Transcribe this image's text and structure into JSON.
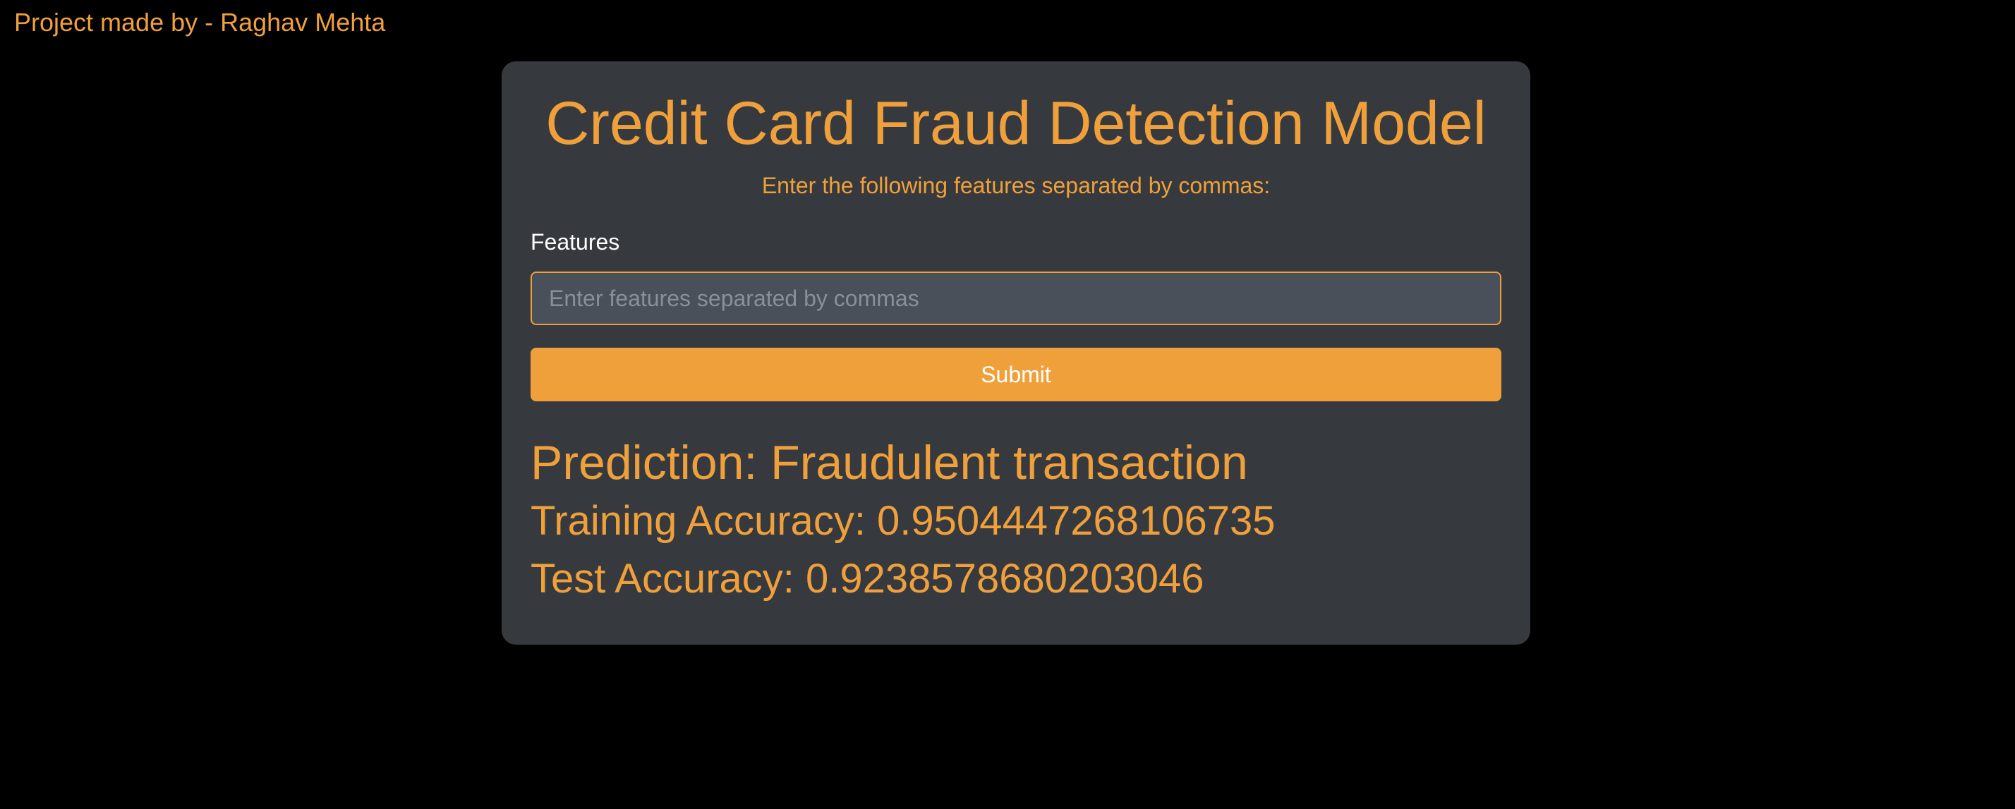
{
  "credit_text": "Project made by - Raghav Mehta",
  "card": {
    "title": "Credit Card Fraud Detection Model",
    "subtitle": "Enter the following features separated by commas:",
    "field_label": "Features",
    "input": {
      "value": "",
      "placeholder": "Enter features separated by commas"
    },
    "submit_label": "Submit",
    "prediction": "Prediction: Fraudulent transaction",
    "training_accuracy": "Training Accuracy: 0.9504447268106735",
    "test_accuracy": "Test Accuracy: 0.9238578680203046"
  },
  "colors": {
    "accent": "#f0a03b",
    "card_background": "#363a3f",
    "page_background": "#000000",
    "input_background": "#4a5059"
  }
}
